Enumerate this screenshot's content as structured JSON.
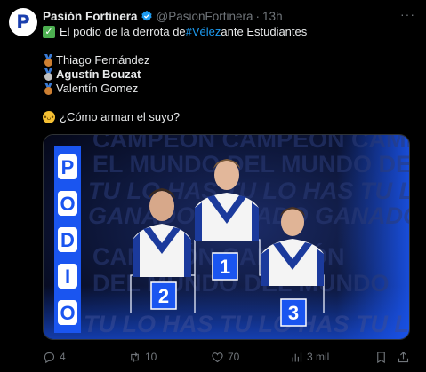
{
  "tweet": {
    "display_name": "Pasión Fortinera",
    "handle": "@PasionFortinera",
    "separator": "·",
    "time": "13h",
    "avatar_glyph": "P",
    "more_label": "···"
  },
  "body": {
    "line1_prefix": "El podio de la derrota de ",
    "line1_hashtag": "#Vélez",
    "line1_suffix": " ante Estudiantes",
    "players": [
      {
        "name": "Thiago Fernández",
        "medal": "bronze-medal-icon",
        "color": "#cd7f32"
      },
      {
        "name": "Agustín Bouzat",
        "medal": "silver-medal-icon",
        "color": "#c0c0c0"
      },
      {
        "name": "Valentín Gomez",
        "medal": "bronze-medal-icon",
        "color": "#cd7f32"
      }
    ],
    "question": "¿Cómo arman el suyo?"
  },
  "image": {
    "vertical_letters": [
      "P",
      "O",
      "D",
      "I",
      "O"
    ],
    "bg_text_rows": [
      "CAMPEÓN CAMPEÓN CAMPEÓN",
      "EL MUNDO DEL MUNDO DEL MUNDO",
      "TU LO HAS TU LO HAS TU LO HAS",
      "GANADO GANADO GANADO",
      "CAMPEÓN CAMPEÓN",
      "DEL MUNDO DEL MUNDO",
      "TU LO HAS TU LO HAS TU LO HAS"
    ],
    "podium": [
      {
        "place": "1"
      },
      {
        "place": "2"
      },
      {
        "place": "3"
      }
    ],
    "colors": {
      "accent": "#1a55f0",
      "bg_dark": "#0b1330",
      "jersey_white": "#f4f4f4",
      "jersey_blue": "#1b3a9c"
    }
  },
  "actions": {
    "reply_count": "4",
    "retweet_count": "10",
    "like_count": "70",
    "views_count": "3 mil"
  },
  "colors": {
    "accent": "#1d9bf0",
    "muted": "#71767b",
    "background": "#000000"
  }
}
